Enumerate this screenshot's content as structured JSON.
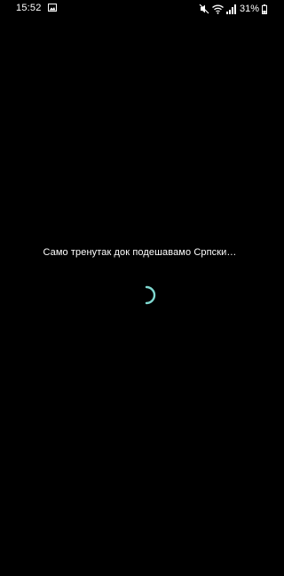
{
  "status_bar": {
    "time": "15:52",
    "battery_percent": "31%",
    "icons": [
      "gallery-icon",
      "mute-icon",
      "wifi-icon",
      "signal-icon",
      "battery-icon"
    ]
  },
  "main": {
    "message": "Само тренутак док подешавамо Српски…",
    "spinner": "loading-spinner"
  },
  "colors": {
    "background": "#000000",
    "text": "#ffffff",
    "spinner_accent": "#7fd8d0"
  }
}
